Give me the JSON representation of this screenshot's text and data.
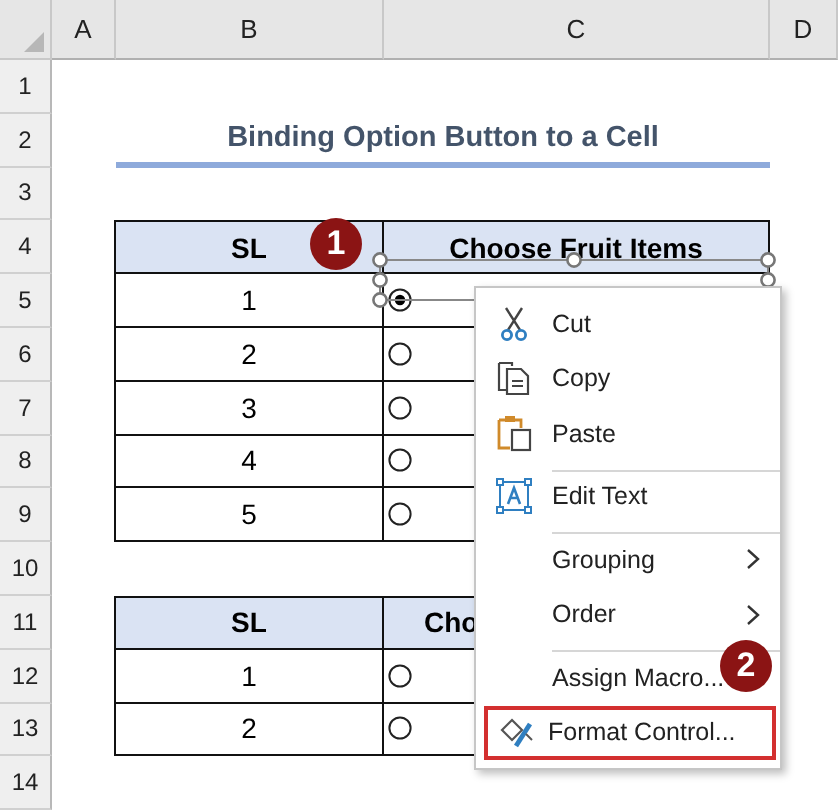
{
  "columns": [
    "A",
    "B",
    "C",
    "D"
  ],
  "row_numbers": [
    "1",
    "2",
    "3",
    "4",
    "5",
    "6",
    "7",
    "8",
    "9",
    "10",
    "11",
    "12",
    "13",
    "14"
  ],
  "title": "Binding Option Button to a Cell",
  "tables": [
    {
      "headers": [
        "SL",
        "Choose Fruit Items"
      ],
      "rows": [
        {
          "sl": "1",
          "selected": true
        },
        {
          "sl": "2",
          "selected": false
        },
        {
          "sl": "3",
          "selected": false
        },
        {
          "sl": "4",
          "selected": false
        },
        {
          "sl": "5",
          "selected": false
        }
      ]
    },
    {
      "headers": [
        "SL",
        "Cho"
      ],
      "rows": [
        {
          "sl": "1",
          "selected": false
        },
        {
          "sl": "2",
          "selected": false
        }
      ]
    }
  ],
  "context_menu": {
    "items": [
      {
        "label": "Cut",
        "separator_before": false,
        "submenu": false,
        "highlighted": false
      },
      {
        "label": "Copy",
        "separator_before": false,
        "submenu": false,
        "highlighted": false
      },
      {
        "label": "Paste",
        "separator_before": false,
        "submenu": false,
        "highlighted": false
      },
      {
        "label": "Edit Text",
        "separator_before": true,
        "submenu": false,
        "highlighted": false
      },
      {
        "label": "Grouping",
        "separator_before": true,
        "submenu": true,
        "highlighted": false
      },
      {
        "label": "Order",
        "separator_before": false,
        "submenu": true,
        "highlighted": false
      },
      {
        "label": "Assign Macro...",
        "separator_before": true,
        "submenu": false,
        "highlighted": false
      },
      {
        "label": "Format Control...",
        "separator_before": false,
        "submenu": false,
        "highlighted": true
      }
    ]
  },
  "callouts": [
    "1",
    "2"
  ]
}
